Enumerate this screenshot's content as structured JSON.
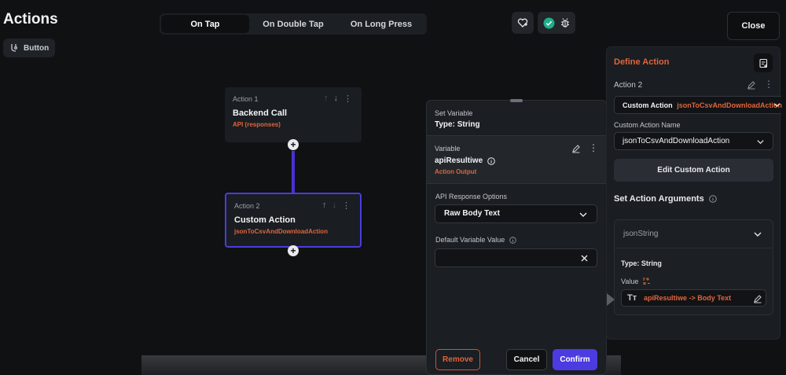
{
  "header": {
    "title": "Actions",
    "button_chip": "Button",
    "tabs": [
      "On Tap",
      "On Double Tap",
      "On Long Press"
    ],
    "active_tab": "On Tap",
    "close_label": "Close"
  },
  "canvas": {
    "nodes": [
      {
        "label": "Action 1",
        "name": "Backend Call",
        "sub": "API (responses)"
      },
      {
        "label": "Action 2",
        "name": "Custom Action",
        "sub": "jsonToCsvAndDownloadAction"
      }
    ]
  },
  "set_variable": {
    "heading": "Set Variable",
    "type": "Type: String",
    "variable_label": "Variable",
    "variable_name": "apiResultiwe",
    "variable_source": "Action Output",
    "api_options_label": "API Response Options",
    "api_options_value": "Raw Body Text",
    "default_label": "Default Variable Value",
    "default_value": "",
    "remove_label": "Remove",
    "cancel_label": "Cancel",
    "confirm_label": "Confirm"
  },
  "define_action": {
    "heading": "Define Action",
    "action_label": "Action 2",
    "custom_action_prefix": "Custom Action",
    "custom_action_value": "jsonToCsvAndDownloadAction",
    "custom_action_name_label": "Custom Action Name",
    "custom_action_name_value": "jsonToCsvAndDownloadAction",
    "edit_button": "Edit Custom Action",
    "arguments_heading": "Set Action Arguments",
    "argument_name": "jsonString",
    "argument_type": "Type: String",
    "value_label": "Value",
    "value_text": "apiResultiwe -> Body Text"
  },
  "colors": {
    "accent": "#4b3be0",
    "orange": "#e0653b",
    "connector": "#4b2fd6",
    "check": "#1fae8a"
  }
}
